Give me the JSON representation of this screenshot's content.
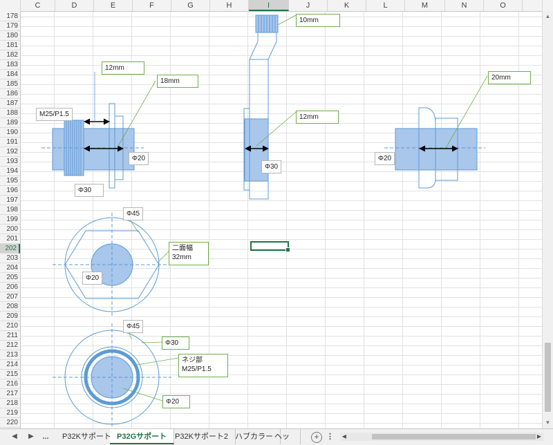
{
  "columns": [
    "C",
    "D",
    "E",
    "F",
    "G",
    "H",
    "I",
    "J",
    "K",
    "L",
    "M",
    "N",
    "O"
  ],
  "selected_column": "I",
  "rows": [
    "178",
    "179",
    "180",
    "181",
    "182",
    "183",
    "184",
    "185",
    "186",
    "187",
    "188",
    "189",
    "190",
    "191",
    "192",
    "193",
    "194",
    "195",
    "196",
    "197",
    "198",
    "199",
    "200",
    "201",
    "202",
    "203",
    "204",
    "205",
    "206",
    "207",
    "208",
    "209",
    "210",
    "211",
    "212",
    "213",
    "214",
    "215",
    "216",
    "217",
    "218",
    "219",
    "220"
  ],
  "selected_row": "202",
  "callouts": {
    "c_12mm": "12mm",
    "c_18mm": "18mm",
    "c_thread": "M25/P1.5",
    "c_phi20_left": "Φ20",
    "c_phi30_left": "Φ30",
    "c_10mm": "10mm",
    "c_12mm_mid": "12mm",
    "c_phi30_mid": "Φ30",
    "c_20mm": "20mm",
    "c_phi20_right": "Φ20",
    "c_phi45_top": "Φ45",
    "c_across_flats_1": "二面幅",
    "c_across_flats_2": "32mm",
    "c_phi20_hex": "Φ20",
    "c_phi45_bottom": "Φ45",
    "c_phi30_bottom": "Φ30",
    "c_screw_1": "ネジ部",
    "c_screw_2": "M25/P1.5",
    "c_phi20_bottom": "Φ20"
  },
  "tabs": {
    "more": "...",
    "t1": "P32Kサポート",
    "t2": "P32Gサポート",
    "t3": "P32Kサポート2",
    "t4": "ハブカラー",
    "t5": "ヘッド:",
    "more2": "..."
  },
  "colors": {
    "accent": "#217346",
    "shape_fill": "#a9c6eb",
    "shape_line": "#5b9bd5",
    "callout_border": "#70ad47"
  }
}
